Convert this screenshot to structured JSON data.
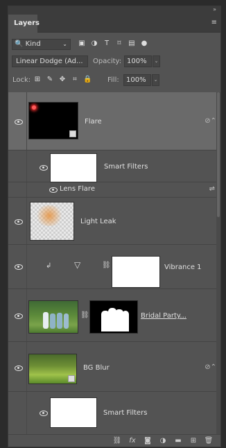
{
  "panel": {
    "tab_label": "Layers"
  },
  "filter": {
    "kind_label": "Kind",
    "icons": [
      "image-filter-icon",
      "adjustment-filter-icon",
      "type-filter-icon",
      "shape-filter-icon",
      "smart-object-filter-icon",
      "filter-toggle-icon"
    ]
  },
  "blend": {
    "mode_label": "Linear Dodge (Ad...",
    "opacity_label": "Opacity:",
    "opacity_value": "100%",
    "lock_label": "Lock:",
    "fill_label": "Fill:",
    "fill_value": "100%"
  },
  "layers": [
    {
      "name": "Flare",
      "type": "smart-object",
      "selected": true
    },
    {
      "name": "Smart Filters",
      "type": "smart-filters-mask"
    },
    {
      "name": "Lens Flare",
      "type": "filter-entry"
    },
    {
      "name": "Light Leak",
      "type": "pixel"
    },
    {
      "name": "Vibrance 1",
      "type": "adjustment"
    },
    {
      "name": "Bridal Party...",
      "type": "masked-pixel"
    },
    {
      "name": "BG Blur",
      "type": "smart-object"
    },
    {
      "name": "Smart Filters",
      "type": "smart-filters-mask"
    }
  ],
  "colors": {
    "panel_bg": "#535353",
    "selected_row": "#6a6a6a",
    "header_bg": "#3c3c3c"
  }
}
